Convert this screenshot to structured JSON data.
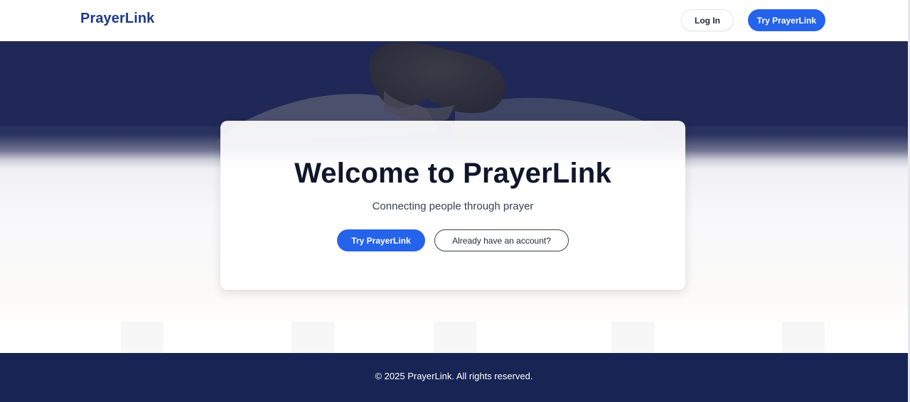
{
  "header": {
    "brand": "PrayerLink",
    "login_label": "Log In",
    "try_label": "Try PrayerLink"
  },
  "hero": {
    "title": "Welcome to PrayerLink",
    "subtitle": "Connecting people through prayer",
    "primary_button": "Try PrayerLink",
    "secondary_button": "Already have an account?"
  },
  "footer": {
    "copyright": "© 2025 PrayerLink. All rights reserved."
  },
  "colors": {
    "brand": "#1e3a8a",
    "accent": "#2563eb",
    "navy": "#172454"
  }
}
